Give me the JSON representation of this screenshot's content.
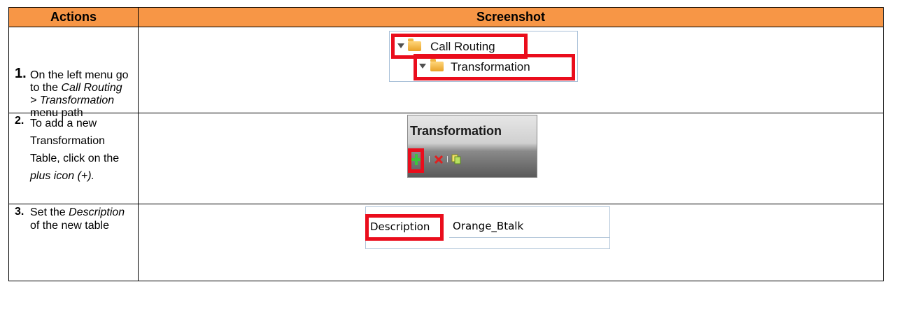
{
  "header": {
    "actions": "Actions",
    "screenshot": "Screenshot"
  },
  "steps": [
    {
      "number": "1.",
      "lines": [
        [
          {
            "t": "On the left menu go",
            "i": false
          }
        ],
        [
          {
            "t": "to the ",
            "i": false
          },
          {
            "t": "Call Routing",
            "i": true
          }
        ],
        [
          {
            "t": "> Transformation",
            "i": true
          }
        ],
        [
          {
            "t": "menu path",
            "i": false
          }
        ]
      ],
      "shot": {
        "tree_root": "Call Routing",
        "tree_child": "Transformation"
      }
    },
    {
      "number": "2.",
      "lines": [
        [
          {
            "t": "To add a new",
            "i": false
          }
        ],
        [
          {
            "t": "Transformation",
            "i": false
          }
        ],
        [
          {
            "t": "Table, click on the",
            "i": false
          }
        ],
        [
          {
            "t": "plus icon (+).",
            "i": true
          }
        ]
      ],
      "shot": {
        "title": "Transformation",
        "toolbar_icons": [
          "plus-icon",
          "delete-icon",
          "copy-icon"
        ]
      }
    },
    {
      "number": "3.",
      "lines": [
        [
          {
            "t": "Set the ",
            "i": false
          },
          {
            "t": "Description",
            "i": true
          }
        ],
        [
          {
            "t": "of the new table",
            "i": false
          }
        ]
      ],
      "shot": {
        "field_label": "Description",
        "field_value": "Orange_Btalk"
      }
    }
  ],
  "colors": {
    "header_bg": "#f79646",
    "highlight": "#ea0d1c"
  }
}
